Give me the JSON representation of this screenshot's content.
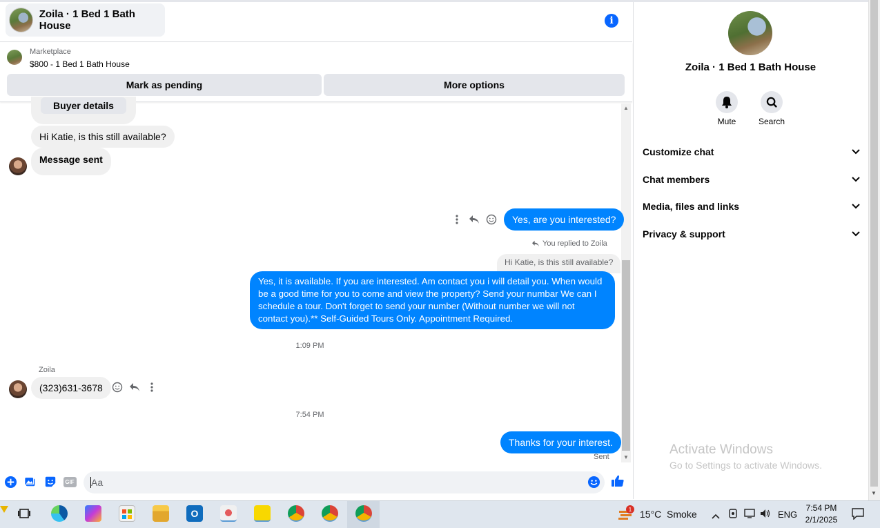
{
  "header": {
    "title": "Zoila · 1 Bed 1 Bath House"
  },
  "marketplace": {
    "label": "Marketplace",
    "listing": "$800 - 1 Bed 1 Bath House",
    "pending_button": "Mark as pending",
    "more_button": "More options"
  },
  "messages": {
    "buyer_details": "Buyer details",
    "incoming_1": "Hi Katie, is this still available?",
    "incoming_2": "Message sent",
    "outgoing_1": "Yes, are you interested?",
    "replied_note": "You replied to Zoila",
    "quoted": "Hi Katie, is this still available?",
    "outgoing_2": "Yes, it is available. If you are interested.  Am contact you i will detail you.  When would be a good time for you to come and view the property? Send your numbar We can I schedule a tour.  Don't forget to send your number (Without number we will not contact you).** Self-Guided Tours Only. Appointment Required.",
    "time_1": "1:09 PM",
    "sender_name": "Zoila",
    "incoming_3": "(323)631-3678",
    "time_2": "7:54 PM",
    "outgoing_3": "Thanks for your interest.",
    "status": "Sent"
  },
  "composer": {
    "placeholder": "Aa",
    "gif_label": "GIF"
  },
  "right_panel": {
    "name": "Zoila · 1 Bed 1 Bath House",
    "mute_label": "Mute",
    "search_label": "Search",
    "sections": [
      "Customize chat",
      "Chat members",
      "Media, files and links",
      "Privacy & support"
    ]
  },
  "watermark": {
    "line1": "Activate Windows",
    "line2": "Go to Settings to activate Windows."
  },
  "taskbar": {
    "weather": "15°C  Smoke",
    "weather_badge": "1",
    "lang": "ENG",
    "time": "7:54 PM",
    "date": "2/1/2025"
  },
  "colors": {
    "accent": "#0084ff",
    "brand": "#0866ff",
    "bubble_in": "#f0f0f0"
  }
}
